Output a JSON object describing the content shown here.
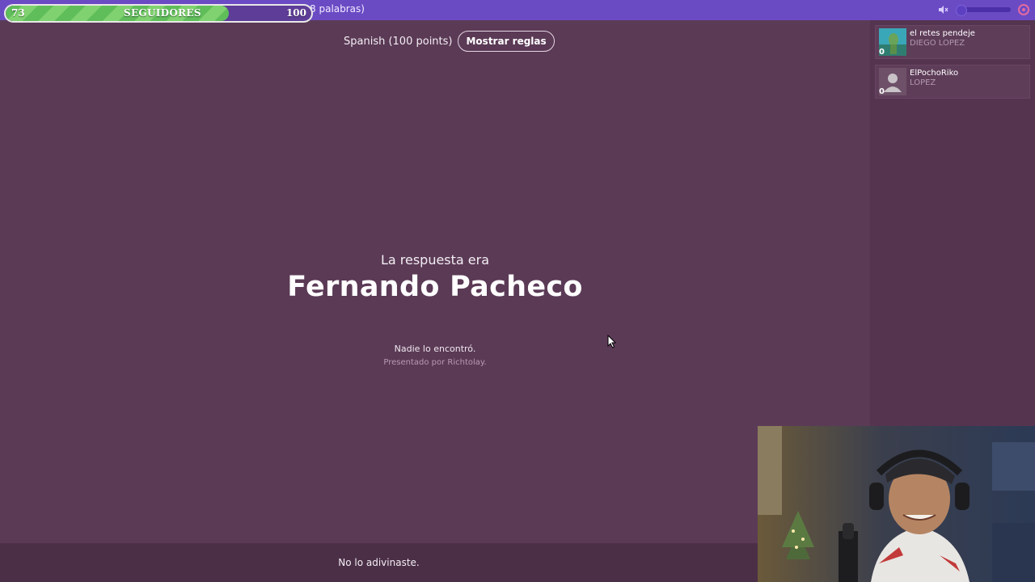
{
  "followers_overlay": {
    "current": "73",
    "label": "SEGUIDORES",
    "goal": "100",
    "progress": 0.73
  },
  "topbar": {
    "faded_text": "n",
    "timer_text": "00:02:18 (28 palabras)",
    "mute_icon": "speaker-muted-icon",
    "corner_icon": "settings-icon"
  },
  "game": {
    "language_label": "Spanish (100 points)",
    "rules_button": "Mostrar reglas",
    "answer_intro": "La respuesta era",
    "answer": "Fernando Pacheco",
    "nobody_found": "Nadie lo encontró.",
    "presented_by": "Presentado por Richtolay."
  },
  "players": [
    {
      "name": "el retes pendeje",
      "subtitle": "DIEGO LOPEZ",
      "score": "0"
    },
    {
      "name": "ElPochoRiko",
      "subtitle": "LOPEZ",
      "score": "0"
    }
  ],
  "bottom_message": "No lo adivinaste.",
  "colors": {
    "background": "#5b3a56",
    "topbar": "#6b4bc4",
    "progress_green": "#6cc862",
    "bottom_bar": "#4b2f47"
  }
}
